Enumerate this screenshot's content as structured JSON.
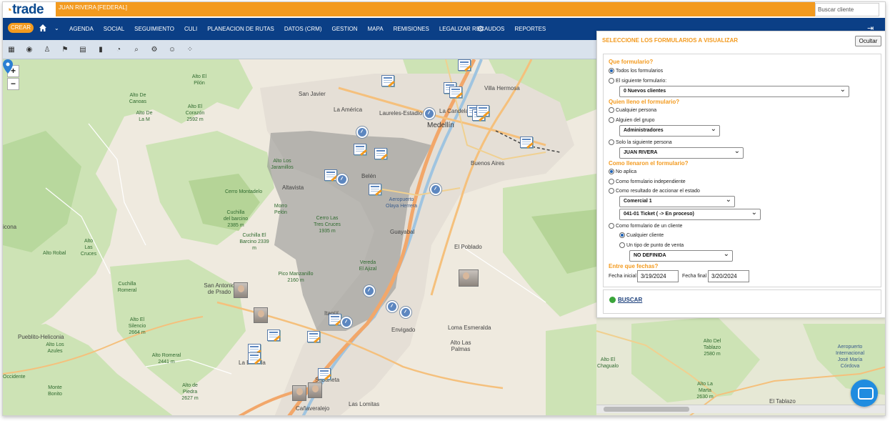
{
  "app": {
    "logo_text": "trade",
    "user_label": "JUAN RIVERA [FEDERAL]",
    "client_search_placeholder": "Buscar cliente"
  },
  "nav": {
    "create_label": "CREAR",
    "items": [
      "AGENDA",
      "SOCIAL",
      "SEGUIMIENTO",
      "CULI",
      "PLANEACION DE RUTAS",
      "DATOS (CRM)",
      "GESTION",
      "MAPA",
      "REMISIONES",
      "LEGALIZAR RECAUDOS",
      "REPORTES"
    ]
  },
  "map": {
    "zoom_in": "+",
    "zoom_out": "−",
    "places": [
      {
        "name": "San Javier",
        "size": "normal"
      },
      {
        "name": "La América",
        "size": "normal"
      },
      {
        "name": "Laureles-Estadio",
        "size": "normal"
      },
      {
        "name": "La Candelaria",
        "size": "normal"
      },
      {
        "name": "Villa Hermosa",
        "size": "normal"
      },
      {
        "name": "Medellín",
        "size": "big"
      },
      {
        "name": "Buenos Aires",
        "size": "normal"
      },
      {
        "name": "Belén",
        "size": "normal"
      },
      {
        "name": "Altavista",
        "size": "normal"
      },
      {
        "name": "Guayabal",
        "size": "normal"
      },
      {
        "name": "El Poblado",
        "size": "normal"
      },
      {
        "name": "Envigado",
        "size": "normal"
      },
      {
        "name": "Loma Esmeralda",
        "size": "normal"
      },
      {
        "name": "Alto Las Palmas",
        "size": "normal"
      },
      {
        "name": "San Antonio de Prado",
        "size": "normal"
      },
      {
        "name": "Pueblito-Heliconia",
        "size": "normal"
      },
      {
        "name": "La Estrella",
        "size": "normal"
      },
      {
        "name": "Sabaneta",
        "size": "normal"
      },
      {
        "name": "Cañaveralejo",
        "size": "normal"
      },
      {
        "name": "Las Lomitas",
        "size": "normal"
      },
      {
        "name": "El Tablazo",
        "size": "normal"
      },
      {
        "name": "Pico Manzanillo 2160 m",
        "size": "green"
      },
      {
        "name": "Cerro Las Tres Cruces 1935 m",
        "size": "green"
      },
      {
        "name": "Cuchilla El Barcino 2339 m",
        "size": "green"
      },
      {
        "name": "Cerro Montadelo",
        "size": "green"
      },
      {
        "name": "Morro Pelón",
        "size": "green"
      },
      {
        "name": "Alto Robal",
        "size": "green"
      },
      {
        "name": "Alto El Silencio 2664 m",
        "size": "green"
      },
      {
        "name": "Alto Romeral 2441 m",
        "size": "green"
      },
      {
        "name": "Alto de Piedra 2627 m",
        "size": "green"
      },
      {
        "name": "Vereda El Ajizal",
        "size": "green"
      },
      {
        "name": "Aeropuerto Olaya Herrera",
        "size": "green"
      },
      {
        "name": "Aeropuerto Internacional José María Córdova",
        "size": "green"
      },
      {
        "name": "Alto Las Cruces",
        "size": "green"
      },
      {
        "name": "Alto El Pilón",
        "size": "green"
      },
      {
        "name": "Alto De Canoas",
        "size": "green"
      },
      {
        "name": "Alto El Corazón 2592 m",
        "size": "green"
      },
      {
        "name": "Alto Los Jaramillos",
        "size": "green"
      },
      {
        "name": "Alto De La M",
        "size": "green"
      },
      {
        "name": "Alto Los Azules",
        "size": "green"
      },
      {
        "name": "Cuchilla Romeral",
        "size": "green"
      },
      {
        "name": "Cuchilla del barcino 2385 m",
        "size": "green"
      },
      {
        "name": "Alto El Chagualo",
        "size": "green"
      },
      {
        "name": "Alto Del Tablazo 2580 m",
        "size": "green"
      },
      {
        "name": "Alto La Marta 2630 m",
        "size": "green"
      },
      {
        "name": "Occidente",
        "size": "green"
      },
      {
        "name": "Monte Bonito",
        "size": "green"
      },
      {
        "name": "Itagüí",
        "size": "normal"
      },
      {
        "name": "icona",
        "size": "normal"
      }
    ]
  },
  "panel": {
    "title": "SELECCIONE LOS FORMULARIOS A VISUALIZAR",
    "hide_label": "Ocultar",
    "q1": "Que formulario?",
    "opt_all_forms": "Todos los formularios",
    "opt_next_form": "El siguiente formulario:",
    "form_select": "0 Nuevos clientes",
    "q2": "Quien lleno el formulario?",
    "opt_any_person": "Cualquier persona",
    "opt_group": "Alguien del grupo",
    "group_select": "Administradores",
    "opt_only_person": "Solo la siguiente persona",
    "person_select": "JUAN RIVERA",
    "q3": "Como llenaron el formulario?",
    "opt_not_apply": "No aplica",
    "opt_independent": "Como formulario independiente",
    "opt_result_state": "Como resultado de accionar el estado",
    "state_select_1": "Comercial 1",
    "state_select_2": "041-01 Ticket ( -> En proceso)",
    "opt_client_form": "Como formulario de un cliente",
    "opt_any_client": "Cualquier cliente",
    "opt_point_type": "Un tipo de punto de venta",
    "point_select": "NO DEFINIDA",
    "q4": "Entre que fechas?",
    "start_label": "Fecha inicial",
    "start_value": "3/19/2024",
    "end_label": "Fecha final",
    "end_value": "3/20/2024",
    "search_label": "BUSCAR"
  },
  "colors": {
    "brand_orange": "#f39a1e",
    "nav_blue": "#0b3f86",
    "accent_green": "#3aa53a"
  }
}
